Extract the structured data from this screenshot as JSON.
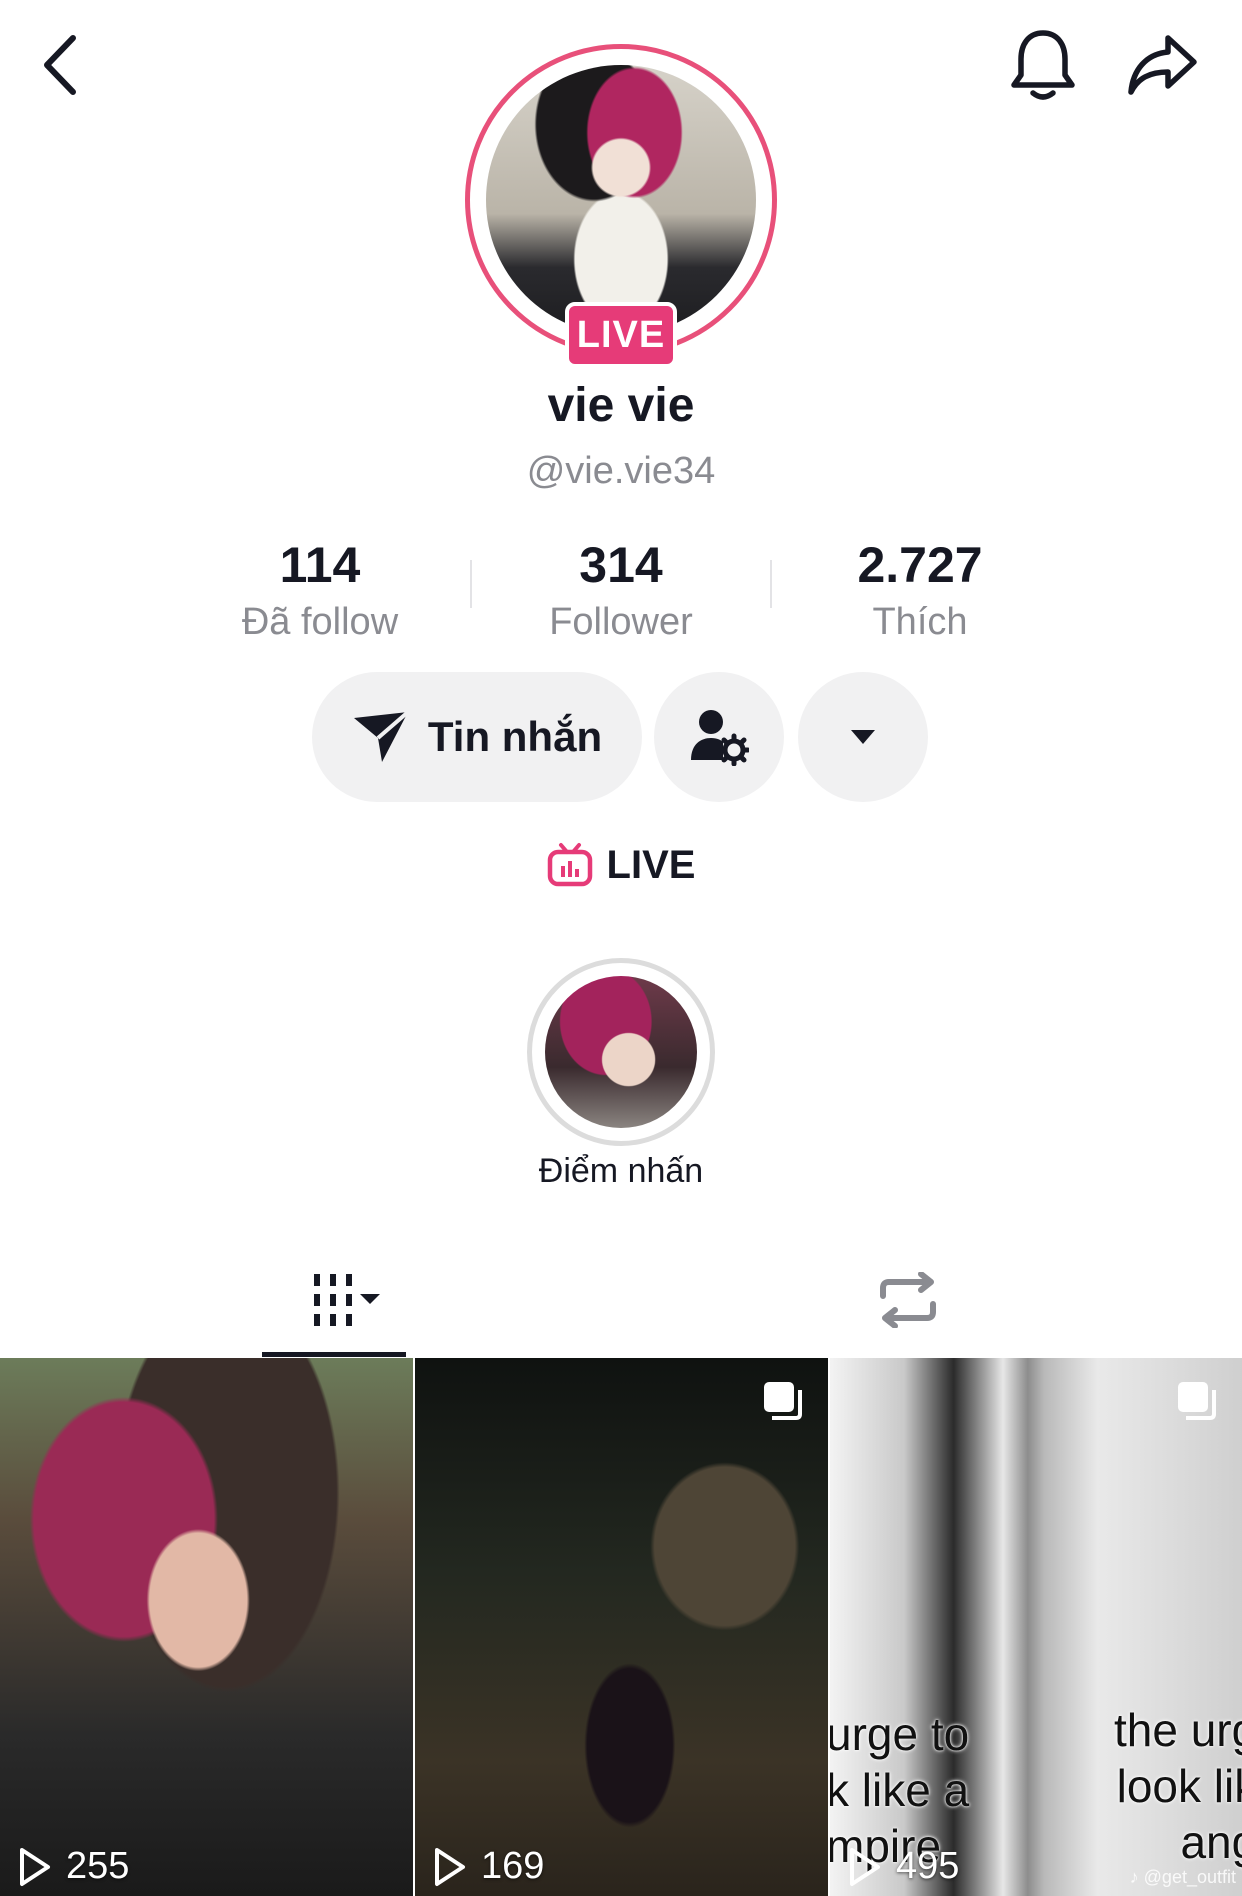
{
  "profile": {
    "live_badge": "LIVE",
    "display_name": "vie vie",
    "username": "@vie.vie34"
  },
  "stats": [
    {
      "value": "114",
      "label": "Đã follow"
    },
    {
      "value": "314",
      "label": "Follower"
    },
    {
      "value": "2.727",
      "label": "Thích"
    }
  ],
  "actions": {
    "message_label": "Tin nhắn"
  },
  "live_link": {
    "label": "LIVE"
  },
  "highlight": {
    "label": "Điểm nhấn"
  },
  "videos": [
    {
      "views": "255",
      "multi": false
    },
    {
      "views": "169",
      "multi": true
    },
    {
      "views": "495",
      "multi": true,
      "overlay_left": [
        "urge to",
        "k like a",
        "mpire"
      ],
      "overlay_right": [
        "the urg",
        "look lik",
        "ang"
      ],
      "watermark": "♪ @get_outfit"
    }
  ],
  "colors": {
    "accent_live": "#e63b78",
    "ring": "#e8507a",
    "text_primary": "#161823",
    "text_secondary": "#8a8b91",
    "button_bg": "#f1f1f2"
  },
  "icons": [
    "back-icon",
    "bell-icon",
    "share-icon",
    "send-icon",
    "person-gear-icon",
    "caret-down-icon",
    "live-tv-icon",
    "grid-icon",
    "repost-icon",
    "play-icon",
    "multi-photo-icon"
  ]
}
